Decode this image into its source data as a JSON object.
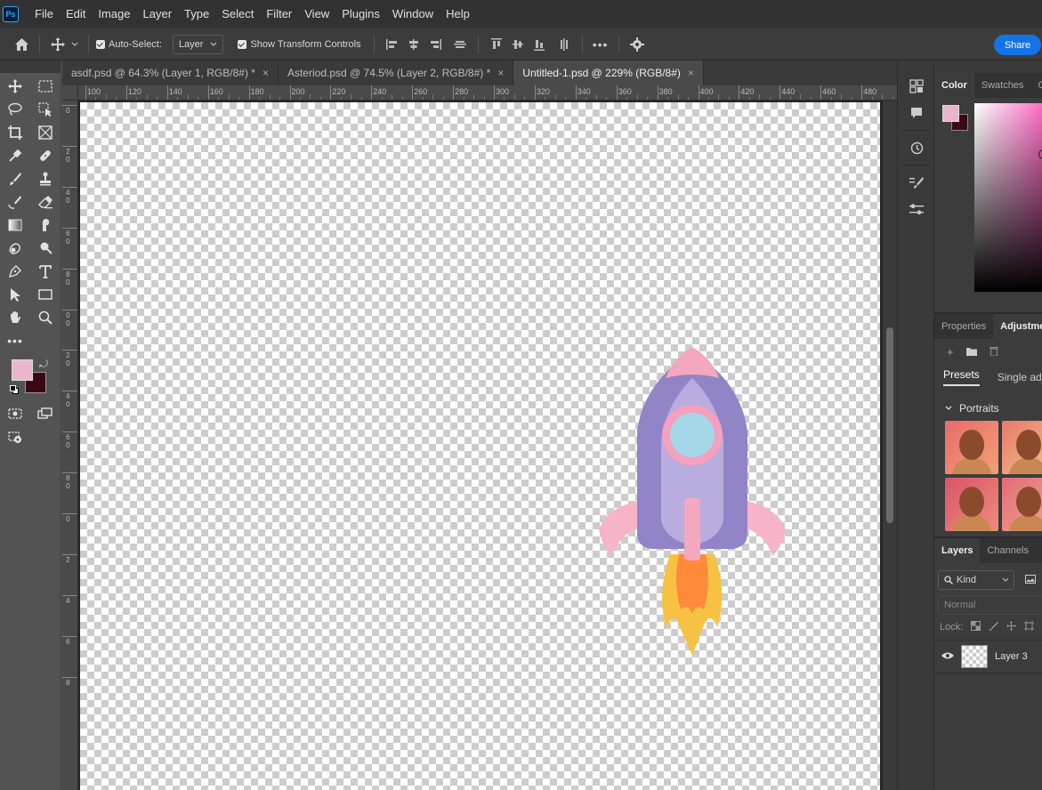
{
  "app": {
    "logo_text": "Ps"
  },
  "menu": [
    "File",
    "Edit",
    "Image",
    "Layer",
    "Type",
    "Select",
    "Filter",
    "View",
    "Plugins",
    "Window",
    "Help"
  ],
  "options": {
    "auto_select_label": "Auto-Select:",
    "auto_select_value": "Layer",
    "show_transform_label": "Show Transform Controls",
    "more_label": "•••",
    "share_label": "Share"
  },
  "tabs": [
    {
      "label": "asdf.psd @ 64.3% (Layer 1, RGB/8#) *",
      "close": "×"
    },
    {
      "label": "Asteriod.psd @ 74.5% (Layer 2, RGB/8#) *",
      "close": "×"
    },
    {
      "label": "Untitled-1.psd @ 229% (RGB/8#)",
      "close": "×"
    }
  ],
  "ruler": {
    "top_ticks": [
      "100",
      "120",
      "140",
      "160",
      "180",
      "200",
      "220",
      "240",
      "260",
      "280",
      "300",
      "320",
      "340",
      "360",
      "380",
      "400",
      "420",
      "440",
      "460",
      "480"
    ],
    "left_ticks": [
      "0",
      "2 0",
      "4 0",
      "6 0",
      "8 0",
      "0 0",
      "2 0",
      "4 0",
      "6 0",
      "8 0",
      "0",
      "2",
      "4",
      "6",
      "8"
    ]
  },
  "toolbox": {
    "more_label": "•••"
  },
  "color_panel": {
    "tabs": [
      "Color",
      "Swatches",
      "Gr"
    ],
    "foreground": "#e8b5cc",
    "background": "#3a0a14"
  },
  "adjustments_panel": {
    "tabs": [
      "Properties",
      "Adjustme"
    ],
    "subtabs": [
      "Presets",
      "Single adju"
    ],
    "section": "Portraits"
  },
  "layers_panel": {
    "tabs": [
      "Layers",
      "Channels",
      "P"
    ],
    "filter": "Kind",
    "blend_mode": "Normal",
    "lock_label": "Lock:",
    "layers": [
      {
        "name": "Layer 3"
      }
    ]
  }
}
